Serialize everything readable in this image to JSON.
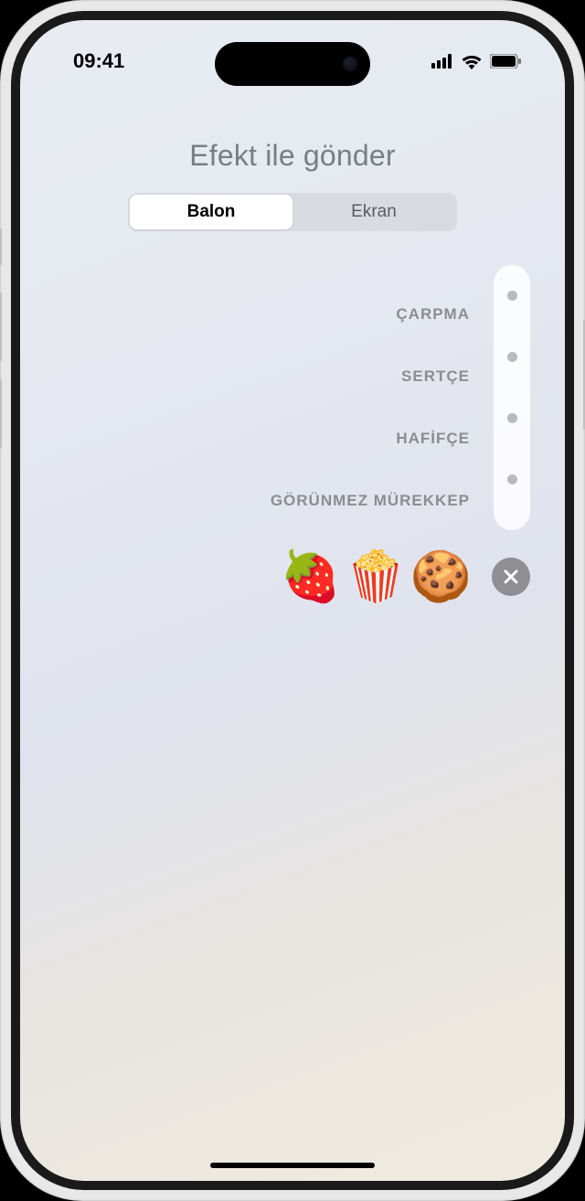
{
  "status": {
    "time": "09:41"
  },
  "header": {
    "title": "Efekt ile gönder"
  },
  "segments": {
    "balloon": "Balon",
    "screen": "Ekran"
  },
  "effects": [
    {
      "label": "ÇARPMA"
    },
    {
      "label": "SERTÇE"
    },
    {
      "label": "HAFİFÇE"
    },
    {
      "label": "GÖRÜNMEZ MÜREKKEP"
    }
  ],
  "message": {
    "content": "🍓🍿🍪"
  }
}
